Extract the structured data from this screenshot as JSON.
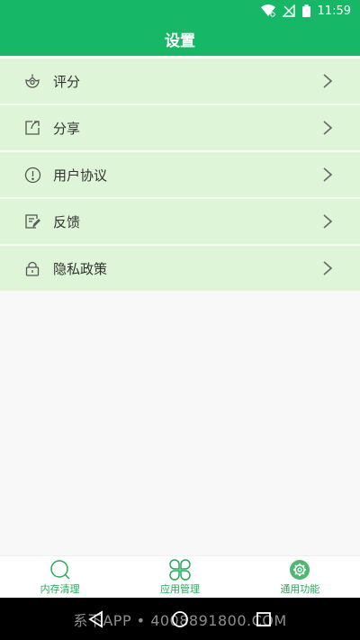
{
  "status_bar": {
    "time": "11:59"
  },
  "header": {
    "title": "设置"
  },
  "menu": [
    {
      "label": "评分",
      "icon": "rating-icon"
    },
    {
      "label": "分享",
      "icon": "share-icon"
    },
    {
      "label": "用户协议",
      "icon": "info-icon"
    },
    {
      "label": "反馈",
      "icon": "feedback-icon"
    },
    {
      "label": "隐私政策",
      "icon": "lock-icon"
    }
  ],
  "tabs": [
    {
      "label": "内存清理",
      "icon": "search-icon"
    },
    {
      "label": "应用管理",
      "icon": "clover-icon"
    },
    {
      "label": "通用功能",
      "icon": "gear-icon"
    }
  ],
  "watermark": "系下APP • 4008891800.COM",
  "colors": {
    "primary": "#16b766",
    "item_bg": "#dff5d8",
    "tab_text": "#27a85a"
  }
}
